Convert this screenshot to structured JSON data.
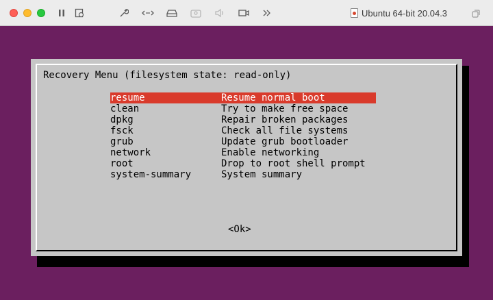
{
  "window": {
    "title": "Ubuntu 64-bit 20.04.3",
    "toolbar_icons": [
      "pause-icon",
      "snapshot-icon",
      "settings-wrench-icon",
      "network-arrows-icon",
      "disk-icon",
      "camera-user-icon",
      "speaker-icon",
      "video-camera-icon",
      "more-chevrons-icon"
    ]
  },
  "dialog": {
    "title": "Recovery Menu (filesystem state: read-only)",
    "items": [
      {
        "tag": "resume",
        "desc": "Resume normal boot",
        "selected": true
      },
      {
        "tag": "clean",
        "desc": "Try to make free space"
      },
      {
        "tag": "dpkg",
        "desc": "Repair broken packages"
      },
      {
        "tag": "fsck",
        "desc": "Check all file systems"
      },
      {
        "tag": "grub",
        "desc": "Update grub bootloader"
      },
      {
        "tag": "network",
        "desc": "Enable networking"
      },
      {
        "tag": "root",
        "desc": "Drop to root shell prompt"
      },
      {
        "tag": "system-summary",
        "desc": "System summary"
      }
    ],
    "ok_label": "<Ok>"
  },
  "colors": {
    "desktop_bg": "#6b1f5f",
    "dialog_bg": "#c6c6c6",
    "selection_bg": "#d93a2b"
  }
}
